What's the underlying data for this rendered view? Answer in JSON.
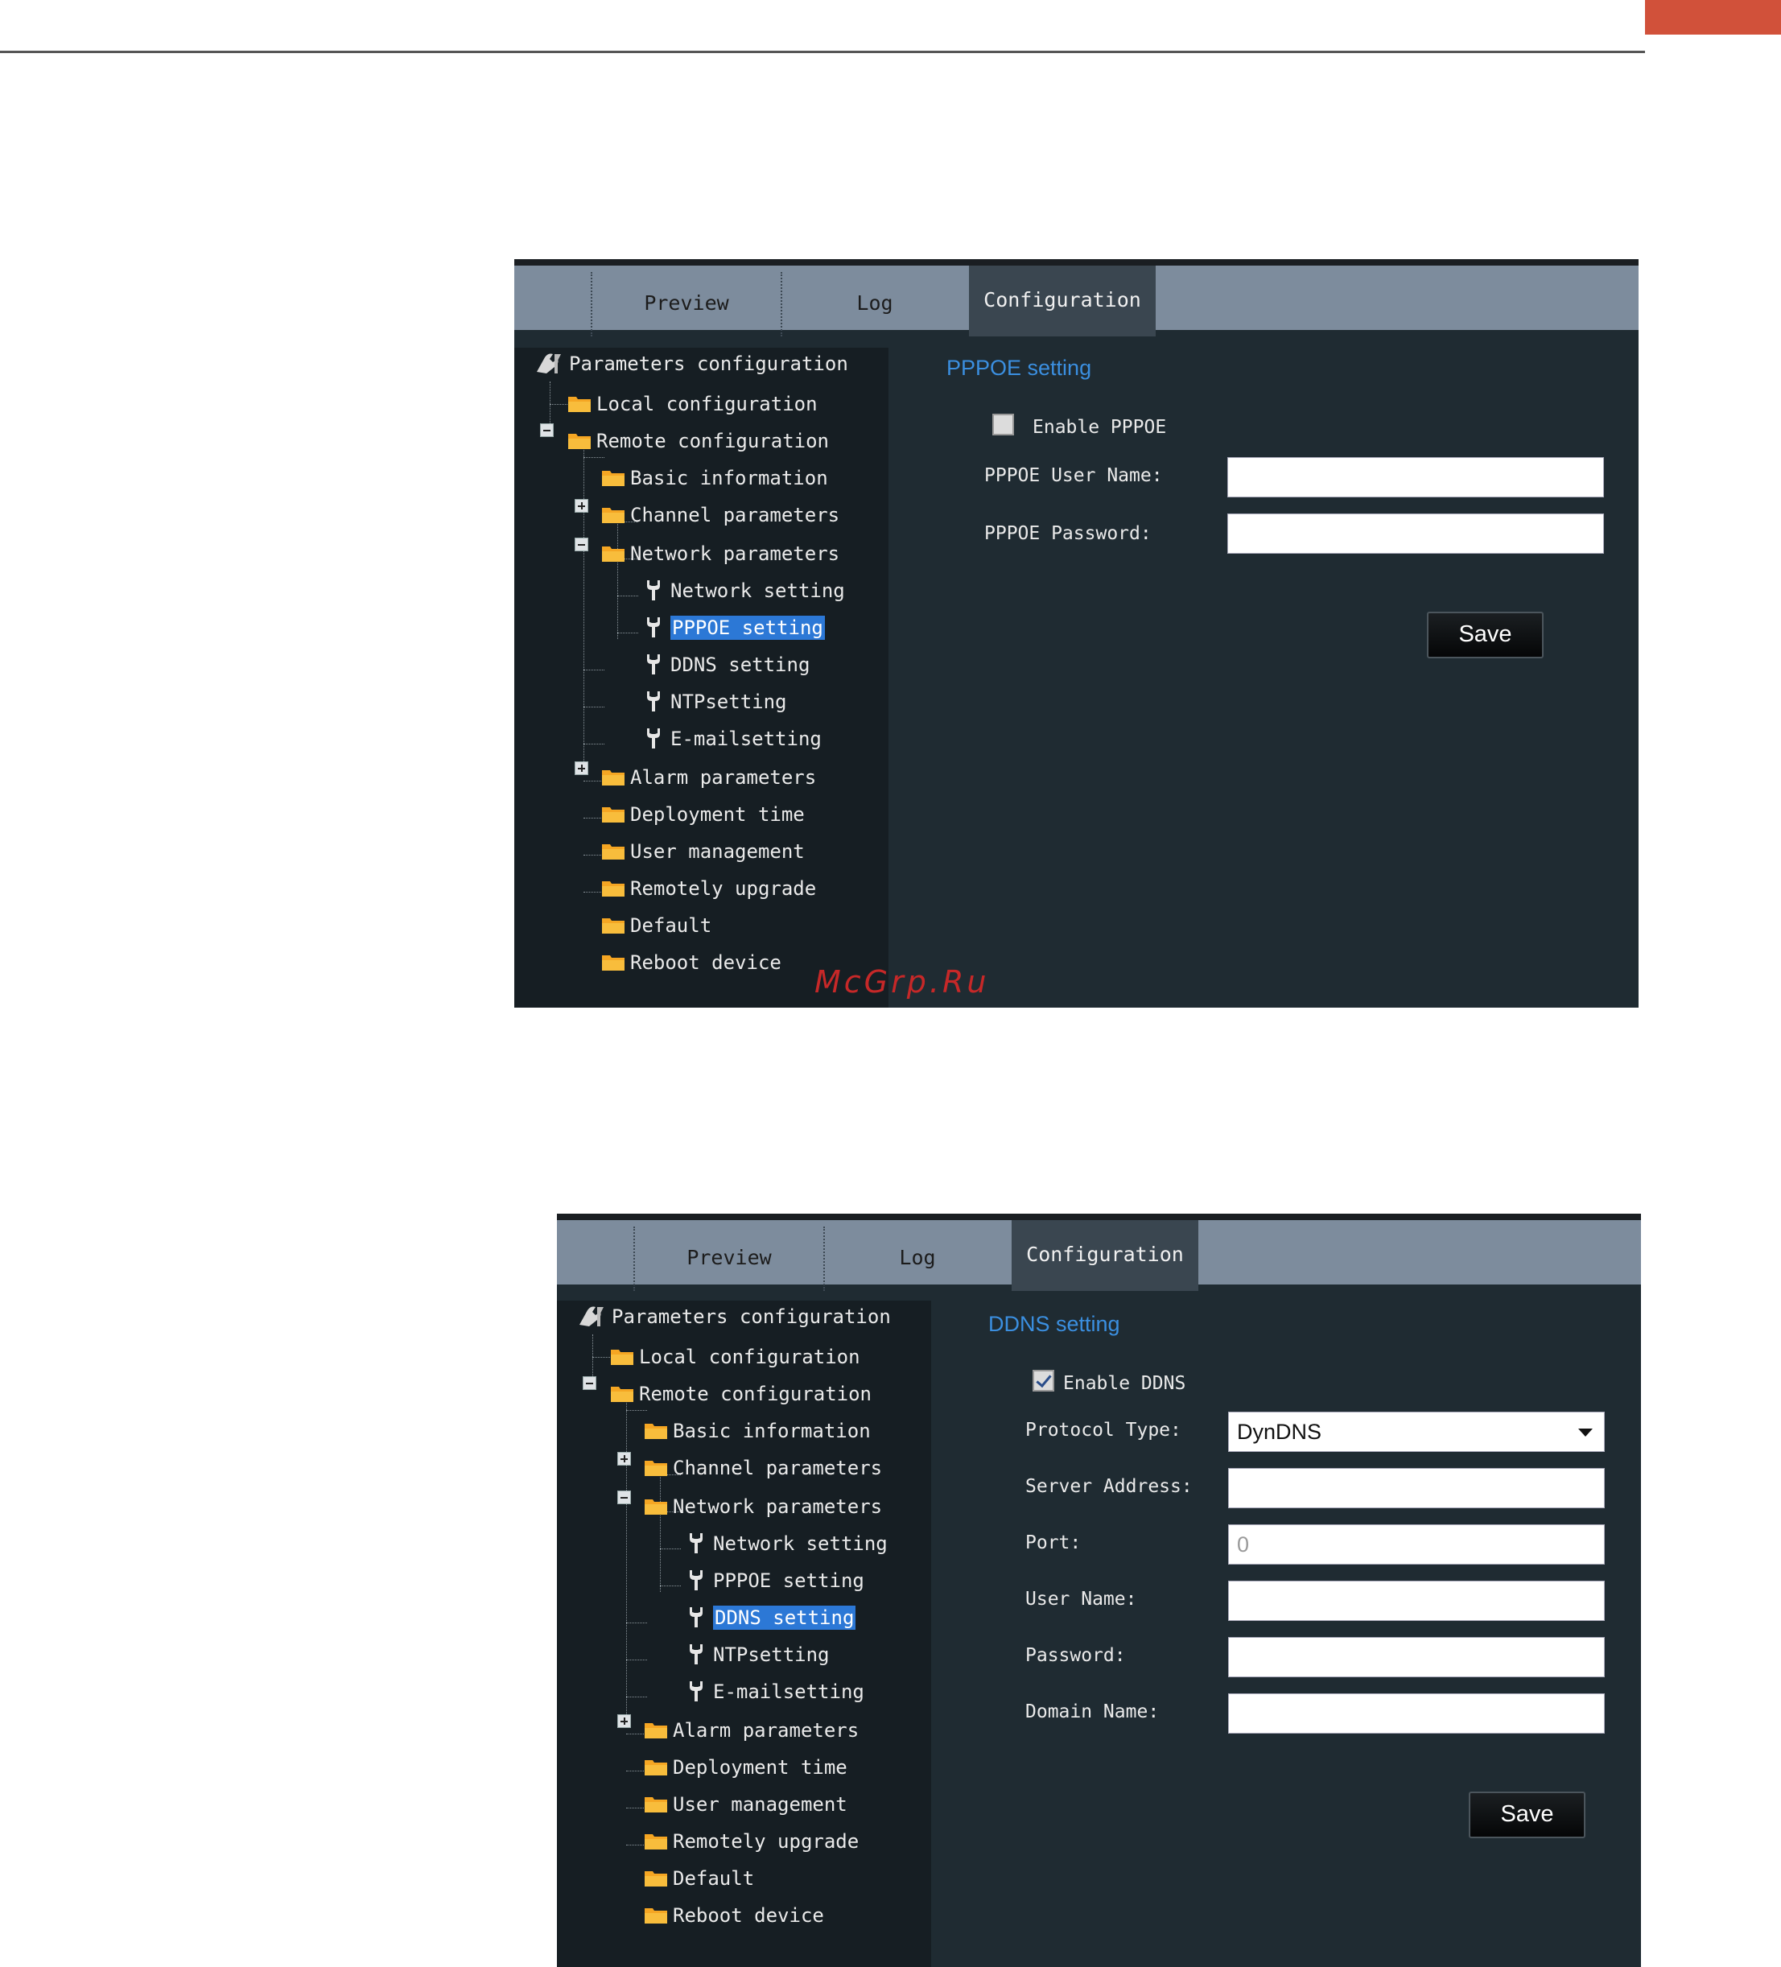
{
  "accent_color": "#d1513a",
  "watermark": "McGrp.Ru",
  "screens": [
    {
      "tabs": {
        "preview": "Preview",
        "log": "Log",
        "configuration": "Configuration"
      },
      "tree": {
        "root": "Parameters configuration",
        "local": "Local configuration",
        "remote": "Remote configuration",
        "basic": "Basic information",
        "channel": "Channel parameters",
        "network": "Network parameters",
        "network_setting": "Network setting",
        "pppoe_setting": "PPPOE setting",
        "ddns_setting": "DDNS setting",
        "ntp_setting": "NTPsetting",
        "email_setting": "E-mailsetting",
        "alarm": "Alarm parameters",
        "deployment": "Deployment time",
        "user_mgmt": "User management",
        "upgrade": "Remotely upgrade",
        "default": "Default",
        "reboot": "Reboot device"
      },
      "form": {
        "title": "PPPOE setting",
        "enable_label": "Enable PPPOE",
        "enabled": false,
        "user_label": "PPPOE User Name:",
        "user_value": "",
        "password_label": "PPPOE Password:",
        "password_value": "",
        "save_label": "Save"
      }
    },
    {
      "tabs": {
        "preview": "Preview",
        "log": "Log",
        "configuration": "Configuration"
      },
      "tree": {
        "root": "Parameters configuration",
        "local": "Local configuration",
        "remote": "Remote configuration",
        "basic": "Basic information",
        "channel": "Channel parameters",
        "network": "Network parameters",
        "network_setting": "Network setting",
        "pppoe_setting": "PPPOE setting",
        "ddns_setting": "DDNS setting",
        "ntp_setting": "NTPsetting",
        "email_setting": "E-mailsetting",
        "alarm": "Alarm parameters",
        "deployment": "Deployment time",
        "user_mgmt": "User management",
        "upgrade": "Remotely upgrade",
        "default": "Default",
        "reboot": "Reboot device"
      },
      "form": {
        "title": "DDNS setting",
        "enable_label": "Enable DDNS",
        "enabled": true,
        "protocol_label": "Protocol Type:",
        "protocol_value": "DynDNS",
        "server_label": "Server Address:",
        "server_value": "",
        "port_label": "Port:",
        "port_value": "0",
        "user_label": "User Name:",
        "user_value": "",
        "password_label": "Password:",
        "password_value": "",
        "domain_label": "Domain Name:",
        "domain_value": "",
        "save_label": "Save"
      }
    }
  ]
}
